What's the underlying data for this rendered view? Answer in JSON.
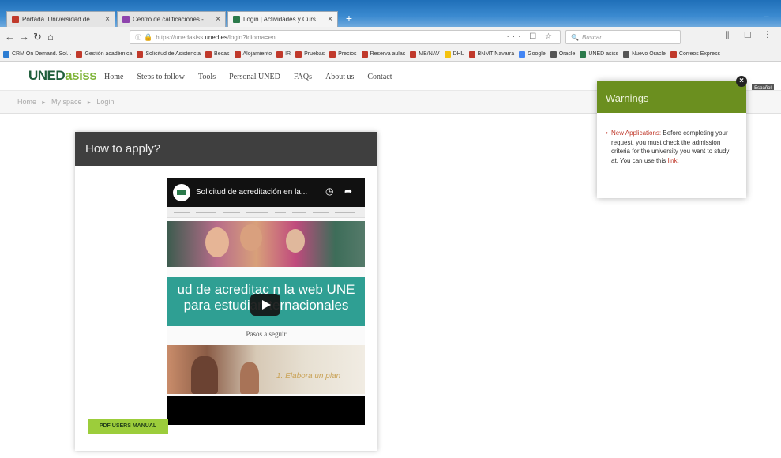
{
  "browser": {
    "tabs": [
      {
        "title": "Portada. Universidad de Nav",
        "color": "#c0392b"
      },
      {
        "title": "Centro de calificaciones - Ed",
        "color": "#8e44ad"
      },
      {
        "title": "Login | Actividades y Cursos | U",
        "color": "#2b7a4b"
      }
    ],
    "new_tab": "+",
    "url_prefix": "https://unedasiss.",
    "url_domain": "uned.es",
    "url_suffix": "/login?idioma=en",
    "url_actions": "··· ☐ ☆",
    "search_placeholder": "Buscar",
    "toolbar_icons": "⫼ ☐ ⋮",
    "bookmarks": [
      {
        "label": "CRM On Demand. Sol...",
        "color": "#2d7dd2"
      },
      {
        "label": "Gestión académica",
        "color": "#c0392b"
      },
      {
        "label": "Solicitud de Asistencia",
        "color": "#c0392b"
      },
      {
        "label": "Becas",
        "color": "#c0392b"
      },
      {
        "label": "Alojamiento",
        "color": "#c0392b"
      },
      {
        "label": "IR",
        "color": "#c0392b"
      },
      {
        "label": "Pruebas",
        "color": "#c0392b"
      },
      {
        "label": "Precios",
        "color": "#c0392b"
      },
      {
        "label": "Reserva aulas",
        "color": "#c0392b"
      },
      {
        "label": "MB/NAV",
        "color": "#c0392b"
      },
      {
        "label": "DHL",
        "color": "#f4c20d"
      },
      {
        "label": "BNMT Navarra",
        "color": "#c0392b"
      },
      {
        "label": "Google",
        "color": "#4285f4"
      },
      {
        "label": "Oracle",
        "color": "#555555"
      },
      {
        "label": "UNED asiss",
        "color": "#2b7a4b"
      },
      {
        "label": "Nuevo Oracle",
        "color": "#555555"
      },
      {
        "label": "Correos Express",
        "color": "#c0392b"
      }
    ]
  },
  "site": {
    "logo_main": "UNED",
    "logo_sub": "asiss",
    "nav": [
      "Home",
      "Steps to follow",
      "Tools",
      "Personal UNED",
      "FAQs",
      "About us",
      "Contact"
    ],
    "breadcrumb": [
      "Home",
      "My space",
      "Login"
    ],
    "lang": "Español"
  },
  "card": {
    "title": "How to apply?",
    "video_title": "Solicitud de acreditación en la...",
    "video_banner_line1": "ud de acreditac   n la web UNE",
    "video_banner_line2": "para estudian   ternacionales",
    "video_steps": "Pasos a seguir",
    "video_step1": "1. Elabora un plan",
    "pdf_button": "PDF USERS MANUAL"
  },
  "warnings": {
    "title": "Warnings",
    "link_label": "New Applications:",
    "text": " Before completing your request, you must check the admission criteria for the university you want to study at. You can use this ",
    "link2": "link",
    "end": "."
  },
  "colors": {
    "warnings_header": "#6b8f1f",
    "card_header": "#3f3f3f",
    "pdf_button": "#9ccd3b",
    "logo_green": "#1f5e3b",
    "video_teal": "#2f9f93"
  }
}
